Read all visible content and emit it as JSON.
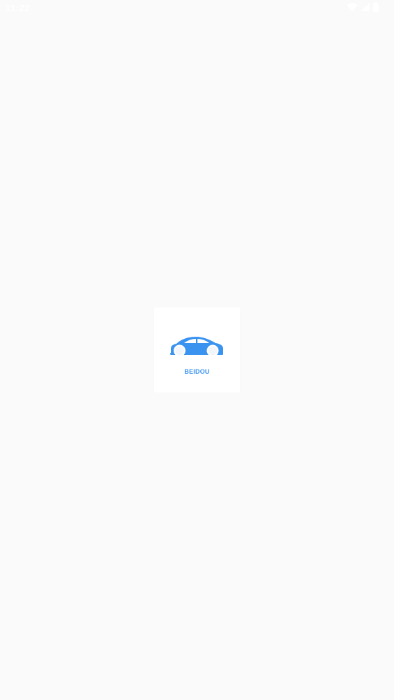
{
  "status_bar": {
    "time": "11:22",
    "icons": [
      "wifi-icon",
      "cell-signal-icon",
      "battery-icon"
    ],
    "icon_color": "#ffffff"
  },
  "splash": {
    "brand_name": "BEIDOU",
    "logo_icon": "car-icon",
    "accent_color": "#3b93f0",
    "background_color": "#fafafa",
    "card_color": "#ffffff"
  }
}
